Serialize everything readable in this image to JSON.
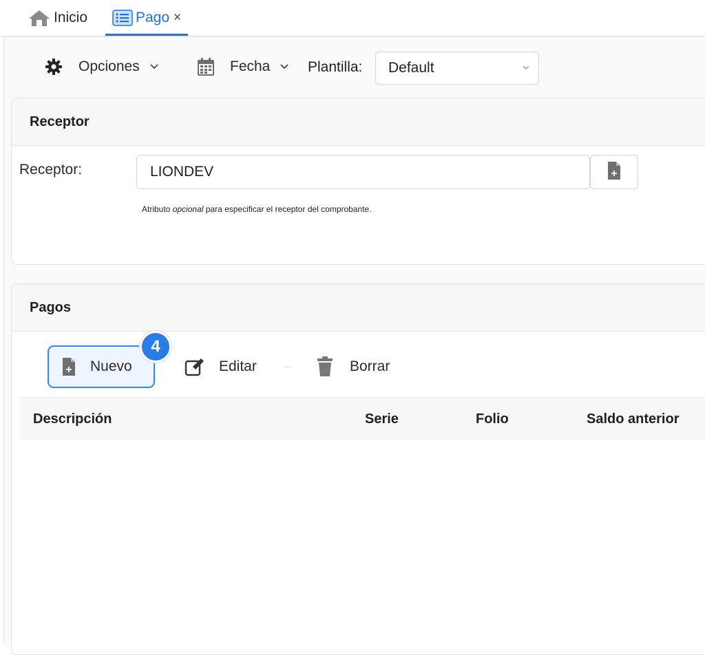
{
  "tabs": [
    {
      "label": "Inicio",
      "icon": "home-icon",
      "active": false
    },
    {
      "label": "Pago",
      "icon": "list-icon",
      "active": true,
      "close": "×"
    }
  ],
  "toolbar": {
    "opciones_label": "Opciones",
    "fecha_label": "Fecha",
    "plantilla_label": "Plantilla:",
    "plantilla_value": "Default"
  },
  "receptor_card": {
    "title": "Receptor",
    "field_label": "Receptor:",
    "field_value": "LIONDEV",
    "help_before": "Atributo ",
    "help_emphasis": "opcional",
    "help_after": " para especificar el receptor del comprobante."
  },
  "pagos_card": {
    "title": "Pagos",
    "step_badge": "4",
    "actions": {
      "nuevo": "Nuevo",
      "editar": "Editar",
      "borrar": "Borrar"
    },
    "columns": [
      "Descripción",
      "Serie",
      "Folio",
      "Saldo anterior"
    ],
    "rows": []
  },
  "colors": {
    "accent": "#1a73e8",
    "highlight_border": "#2f87e8",
    "badge": "#2a7be4"
  }
}
